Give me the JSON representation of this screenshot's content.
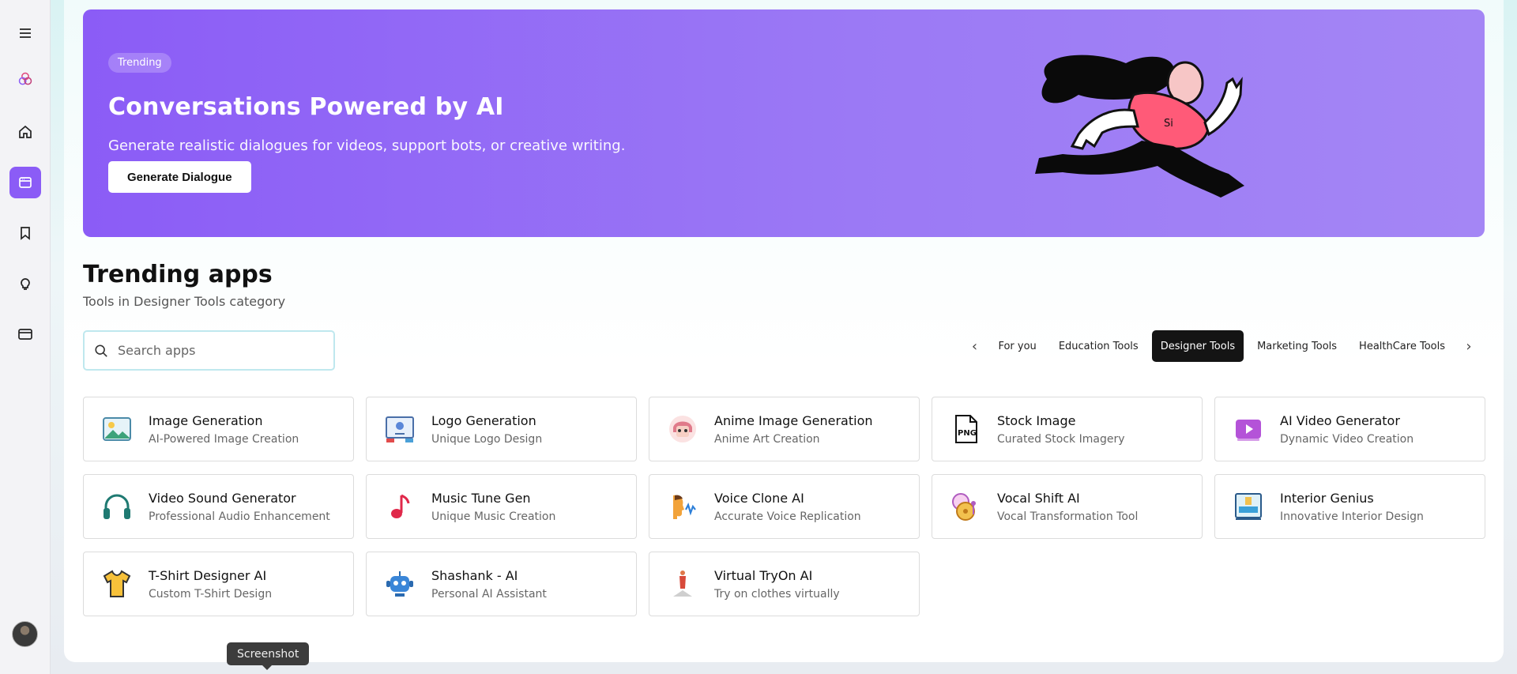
{
  "sidebar": {
    "items": [
      {
        "icon": "menu-icon"
      },
      {
        "icon": "logo-icon"
      },
      {
        "icon": "home-icon"
      },
      {
        "icon": "apps-icon",
        "active": true
      },
      {
        "icon": "bookmark-icon"
      },
      {
        "icon": "lightbulb-icon"
      },
      {
        "icon": "card-icon"
      }
    ],
    "accent": "#8b5cf6"
  },
  "hero": {
    "badge": "Trending",
    "title": "Conversations Powered by AI",
    "subtitle": "Generate realistic dialogues for videos, support bots, or creative writing.",
    "button": "Generate Dialogue",
    "shirt_text": "Si"
  },
  "section": {
    "title": "Trending apps",
    "subtitle": "Tools in Designer Tools category"
  },
  "search": {
    "placeholder": "Search apps"
  },
  "tabs": [
    {
      "label": "For you"
    },
    {
      "label": "Education Tools"
    },
    {
      "label": "Designer Tools",
      "active": true
    },
    {
      "label": "Marketing Tools"
    },
    {
      "label": "HealthCare Tools"
    }
  ],
  "apps": [
    {
      "title": "Image Generation",
      "desc": "AI-Powered Image Creation",
      "icon": "image-icon"
    },
    {
      "title": "Logo Generation",
      "desc": "Unique Logo Design",
      "icon": "logo-design-icon"
    },
    {
      "title": "Anime Image Generation",
      "desc": "Anime Art Creation",
      "icon": "anime-icon"
    },
    {
      "title": "Stock Image",
      "desc": "Curated Stock Imagery",
      "icon": "png-file-icon"
    },
    {
      "title": "AI Video Generator",
      "desc": "Dynamic Video Creation",
      "icon": "video-icon"
    },
    {
      "title": "Video Sound Generator",
      "desc": "Professional Audio Enhancement",
      "icon": "headphones-icon"
    },
    {
      "title": "Music Tune Gen",
      "desc": "Unique Music Creation",
      "icon": "music-note-icon"
    },
    {
      "title": "Voice Clone AI",
      "desc": "Accurate Voice Replication",
      "icon": "voice-icon"
    },
    {
      "title": "Vocal Shift AI",
      "desc": "Vocal Transformation Tool",
      "icon": "vocal-shift-icon"
    },
    {
      "title": "Interior Genius",
      "desc": "Innovative Interior Design",
      "icon": "interior-icon"
    },
    {
      "title": "T-Shirt Designer AI",
      "desc": "Custom T-Shirt Design",
      "icon": "tshirt-icon"
    },
    {
      "title": "Shashank - AI",
      "desc": "Personal AI Assistant",
      "icon": "robot-icon"
    },
    {
      "title": "Virtual TryOn AI",
      "desc": "Try on clothes virtually",
      "icon": "mannequin-icon"
    }
  ],
  "tooltip": "Screenshot"
}
